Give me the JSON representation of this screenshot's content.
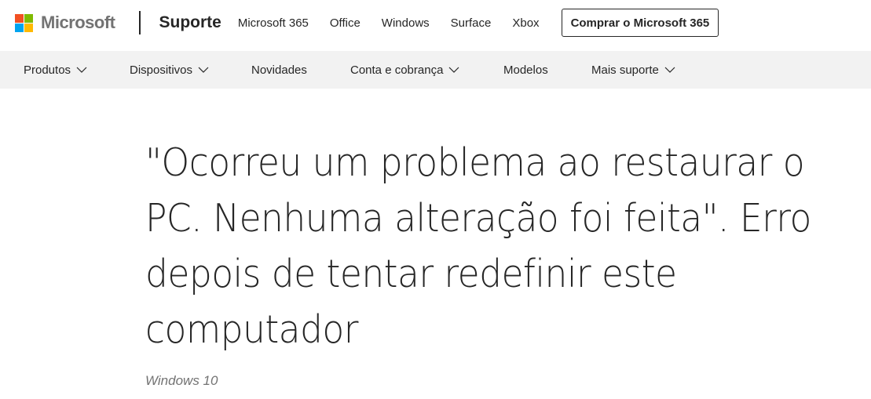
{
  "header": {
    "logo_text": "Microsoft",
    "logo_colors": [
      "#f25022",
      "#7fba00",
      "#00a4ef",
      "#ffb900"
    ],
    "brand": "Suporte",
    "links": [
      "Microsoft 365",
      "Office",
      "Windows",
      "Surface",
      "Xbox"
    ],
    "buy_label": "Comprar o Microsoft 365"
  },
  "subnav": {
    "background": "#f2f2f2",
    "items": [
      {
        "label": "Produtos",
        "dropdown": true
      },
      {
        "label": "Dispositivos",
        "dropdown": true
      },
      {
        "label": "Novidades",
        "dropdown": false
      },
      {
        "label": "Conta e cobrança",
        "dropdown": true
      },
      {
        "label": "Modelos",
        "dropdown": false
      },
      {
        "label": "Mais suporte",
        "dropdown": true
      }
    ]
  },
  "article": {
    "title": "\"Ocorreu um problema ao restaurar o PC. Nenhuma alteração foi feita\". Erro depois de tentar redefinir este computador",
    "applies_to": "Windows 10"
  }
}
